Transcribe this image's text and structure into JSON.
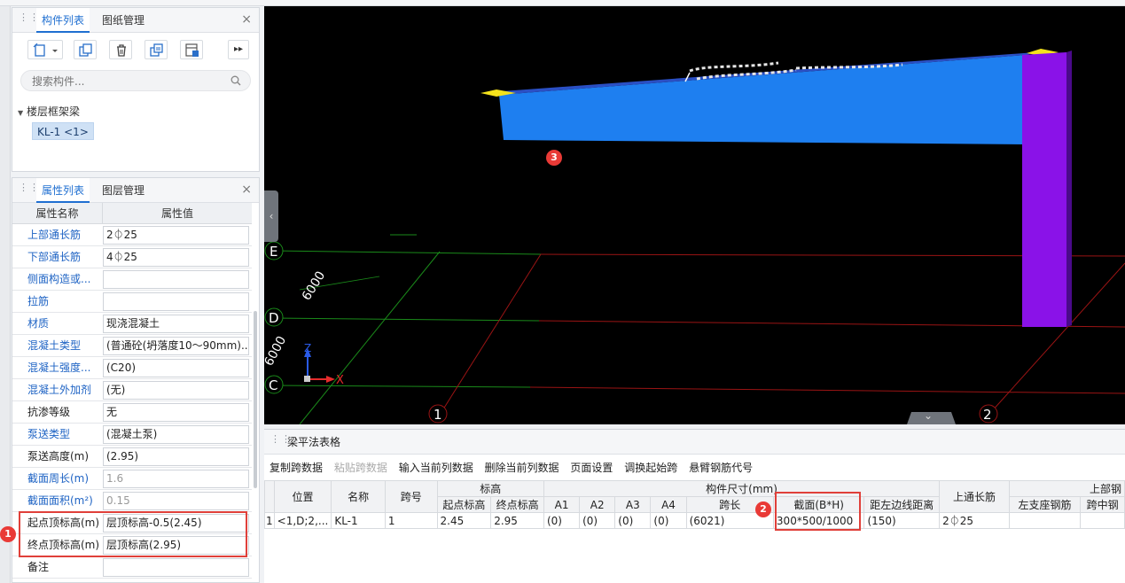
{
  "component_panel": {
    "tabs": [
      "构件列表",
      "图纸管理"
    ],
    "search_placeholder": "搜索构件...",
    "tree_root": "楼层框架梁",
    "tree_leaf": "KL-1 <1>",
    "more_label": "▸▸"
  },
  "property_panel": {
    "tabs": [
      "属性列表",
      "图层管理"
    ],
    "header_name": "属性名称",
    "header_value": "属性值",
    "rows": [
      {
        "name": "上部通长筋",
        "value": "2⏀25"
      },
      {
        "name": "下部通长筋",
        "value": "4⏀25"
      },
      {
        "name": "侧面构造或...",
        "value": ""
      },
      {
        "name": "拉筋",
        "value": ""
      },
      {
        "name": "材质",
        "value": "现浇混凝土"
      },
      {
        "name": "混凝土类型",
        "value": "(普通砼(坍落度10～90mm)..."
      },
      {
        "name": "混凝土强度...",
        "value": "(C20)"
      },
      {
        "name": "混凝土外加剂",
        "value": "(无)"
      },
      {
        "name": "抗渗等级",
        "value": "无"
      },
      {
        "name": "泵送类型",
        "value": "(混凝土泵)"
      },
      {
        "name": "泵送高度(m)",
        "value": "(2.95)"
      },
      {
        "name": "截面周长(m)",
        "value": "1.6"
      },
      {
        "name": "截面面积(m²)",
        "value": "0.15"
      },
      {
        "name": "起点顶标高(m)",
        "value": "层顶标高-0.5(2.45)"
      },
      {
        "name": "终点顶标高(m)",
        "value": "层顶标高(2.95)"
      },
      {
        "name": "备注",
        "value": ""
      }
    ]
  },
  "badges": [
    "1",
    "2",
    "3"
  ],
  "viewport": {
    "grid_labels": [
      "E",
      "D",
      "C",
      "1",
      "2"
    ],
    "dims": [
      "6000",
      "6000"
    ],
    "axis_x": "X",
    "axis_z": "Z",
    "collapse_left": "‹",
    "collapse_down": "⌄",
    "colors": {
      "beam": "#1e7ff0",
      "column": "#8a12e8",
      "grid_green": "#1a8a1a",
      "grid_red": "#9a1414"
    }
  },
  "bottom_panel": {
    "title": "梁平法表格",
    "toolbar": [
      {
        "label": "复制跨数据",
        "enabled": true
      },
      {
        "label": "粘贴跨数据",
        "enabled": false
      },
      {
        "label": "输入当前列数据",
        "enabled": true
      },
      {
        "label": "删除当前列数据",
        "enabled": true
      },
      {
        "label": "页面设置",
        "enabled": true
      },
      {
        "label": "调换起始跨",
        "enabled": true
      },
      {
        "label": "悬臂钢筋代号",
        "enabled": true
      }
    ],
    "headers": {
      "position": "位置",
      "name": "名称",
      "span_no": "跨号",
      "elevation": "标高",
      "start_elev": "起点标高",
      "end_elev": "终点标高",
      "dimensions": "构件尺寸(mm)",
      "a1": "A1",
      "a2": "A2",
      "a3": "A3",
      "a4": "A4",
      "span_length": "跨长",
      "section": "截面(B*H)",
      "edge_distance": "距左边线距离",
      "top_rebar": "上通长筋",
      "top_group": "上部钢",
      "left_support": "左支座钢筋",
      "mid_span": "跨中钢"
    },
    "row": {
      "index": "1",
      "position": "<1,D;2,...",
      "name": "KL-1",
      "span_no": "1",
      "start_elev": "2.45",
      "end_elev": "2.95",
      "a1": "(0)",
      "a2": "(0)",
      "a3": "(0)",
      "a4": "(0)",
      "span_length": "(6021)",
      "section": "300*500/1000",
      "edge_distance": "(150)",
      "top_rebar": "2⏀25",
      "left_support": "",
      "mid_span": ""
    }
  }
}
